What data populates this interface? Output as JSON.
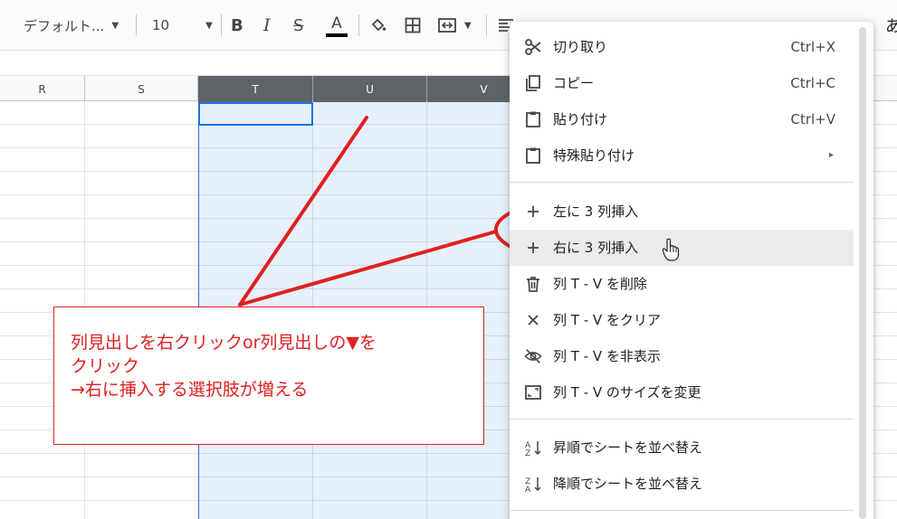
{
  "toolbar": {
    "font_value": "デフォルト...",
    "size_value": "10",
    "bold_label": "B",
    "italic_label": "I",
    "strike_label": "S",
    "text_color_label": "A",
    "right_edge_text": "あ"
  },
  "grid": {
    "columns": [
      {
        "label": "R",
        "selected": false
      },
      {
        "label": "S",
        "selected": false
      },
      {
        "label": "T",
        "selected": true
      },
      {
        "label": "U",
        "selected": true
      },
      {
        "label": "V",
        "selected": true
      }
    ]
  },
  "menu": {
    "groups": [
      [
        {
          "icon": "scissors-icon",
          "label": "切り取り",
          "shortcut": "Ctrl+X"
        },
        {
          "icon": "copy-icon",
          "label": "コピー",
          "shortcut": "Ctrl+C"
        },
        {
          "icon": "clipboard-icon",
          "label": "貼り付け",
          "shortcut": "Ctrl+V"
        },
        {
          "icon": "clipboard-icon",
          "label": "特殊貼り付け",
          "submenu": "▸"
        }
      ],
      [
        {
          "icon": "plus-icon",
          "label": "左に 3 列挿入"
        },
        {
          "icon": "plus-icon",
          "label": "右に 3 列挿入",
          "hovered": true
        },
        {
          "icon": "trash-icon",
          "label": "列 T - V を削除"
        },
        {
          "icon": "close-icon",
          "label": "列 T - V をクリア"
        },
        {
          "icon": "eye-off-icon",
          "label": "列 T - V を非表示"
        },
        {
          "icon": "resize-icon",
          "label": "列 T - V のサイズを変更"
        }
      ],
      [
        {
          "icon": "sort-az-icon",
          "label": "昇順でシートを並べ替え"
        },
        {
          "icon": "sort-za-icon",
          "label": "降順でシートを並べ替え"
        }
      ]
    ]
  },
  "annotation": {
    "line1": "列見出しを右クリックor列見出しの▼を",
    "line2": "クリック",
    "line3": "→右に挿入する選択肢が増える",
    "color": "#e02020"
  }
}
